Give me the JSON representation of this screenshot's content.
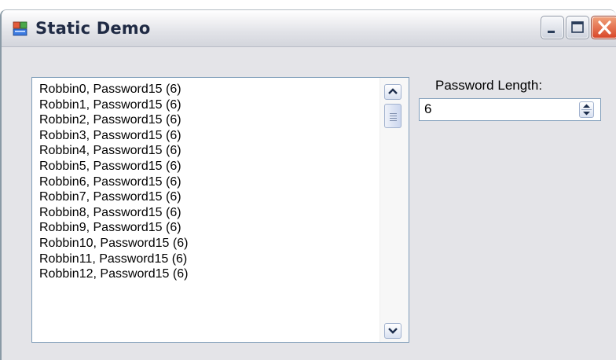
{
  "window": {
    "title": "Static Demo",
    "controls": [
      "minimize",
      "maximize",
      "close"
    ]
  },
  "list": {
    "items": [
      "Robbin0, Password15 (6)",
      "Robbin1, Password15 (6)",
      "Robbin2, Password15 (6)",
      "Robbin3, Password15 (6)",
      "Robbin4, Password15 (6)",
      "Robbin5, Password15 (6)",
      "Robbin6, Password15 (6)",
      "Robbin7, Password15 (6)",
      "Robbin8, Password15 (6)",
      "Robbin9, Password15 (6)",
      "Robbin10, Password15 (6)",
      "Robbin11, Password15 (6)",
      "Robbin12, Password15 (6)"
    ]
  },
  "password_length": {
    "label": "Password Length:",
    "value": "6"
  }
}
